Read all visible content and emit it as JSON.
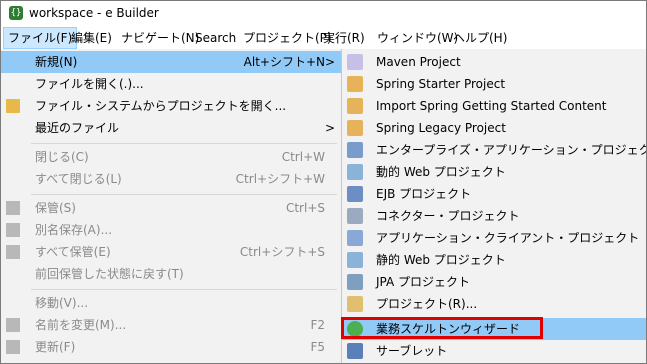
{
  "window": {
    "title": "workspace - e Builder",
    "app_icon": "eclipse-app-icon"
  },
  "menubar": [
    "ファイル(F)",
    "編集(E)",
    "ナビゲート(N)",
    "Search",
    "プロジェクト(P)",
    "実行(R)",
    "ウィンドウ(W)",
    "ヘルプ(H)"
  ],
  "file_menu": [
    {
      "label": "新規(N)",
      "shortcut": "Alt+シフト+N",
      "arrow": ">",
      "icon": ""
    },
    {
      "label": "ファイルを開く(.)...",
      "shortcut": "",
      "arrow": "",
      "icon": ""
    },
    {
      "label": "ファイル・システムからプロジェクトを開く...",
      "shortcut": "",
      "arrow": "",
      "icon": "folder-icon"
    },
    {
      "label": "最近のファイル",
      "shortcut": "",
      "arrow": ">",
      "icon": ""
    },
    {
      "label": "閉じる(C)",
      "shortcut": "Ctrl+W",
      "arrow": "",
      "icon": ""
    },
    {
      "label": "すべて閉じる(L)",
      "shortcut": "Ctrl+シフト+W",
      "arrow": "",
      "icon": ""
    },
    {
      "label": "保管(S)",
      "shortcut": "Ctrl+S",
      "arrow": "",
      "icon": "save-icon"
    },
    {
      "label": "別名保存(A)...",
      "shortcut": "",
      "arrow": "",
      "icon": "save-as-icon"
    },
    {
      "label": "すべて保管(E)",
      "shortcut": "Ctrl+シフト+S",
      "arrow": "",
      "icon": "save-all-icon"
    },
    {
      "label": "前回保管した状態に戻す(T)",
      "shortcut": "",
      "arrow": "",
      "icon": ""
    },
    {
      "label": "移動(V)...",
      "shortcut": "",
      "arrow": "",
      "icon": ""
    },
    {
      "label": "名前を変更(M)...",
      "shortcut": "F2",
      "arrow": "",
      "icon": "rename-icon"
    },
    {
      "label": "更新(F)",
      "shortcut": "F5",
      "arrow": "",
      "icon": "refresh-icon"
    }
  ],
  "new_submenu": [
    {
      "label": "Maven Project",
      "icon": "maven-project-icon"
    },
    {
      "label": "Spring Starter Project",
      "icon": "spring-starter-project-icon"
    },
    {
      "label": "Import Spring Getting Started Content",
      "icon": "spring-import-icon"
    },
    {
      "label": "Spring Legacy Project",
      "icon": "spring-legacy-project-icon"
    },
    {
      "label": "エンタープライズ・アプリケーション・プロジェクト",
      "icon": "enterprise-app-project-icon"
    },
    {
      "label": "動的 Web プロジェクト",
      "icon": "dynamic-web-project-icon"
    },
    {
      "label": "EJB プロジェクト",
      "icon": "ejb-project-icon"
    },
    {
      "label": "コネクター・プロジェクト",
      "icon": "connector-project-icon"
    },
    {
      "label": "アプリケーション・クライアント・プロジェクト",
      "icon": "app-client-project-icon"
    },
    {
      "label": "静的 Web プロジェクト",
      "icon": "static-web-project-icon"
    },
    {
      "label": "JPA プロジェクト",
      "icon": "jpa-project-icon"
    },
    {
      "label": "プロジェクト(R)...",
      "icon": "project-icon"
    },
    {
      "label": "業務スケルトンウィザード",
      "icon": "skeleton-wizard-icon"
    },
    {
      "label": "サーブレット",
      "icon": "servlet-icon"
    }
  ],
  "colors": {
    "highlight": "#91c9f7",
    "menu_bg": "#f2f2f2",
    "red_box": "#e00000",
    "disabled_text": "#8a8a8a"
  }
}
